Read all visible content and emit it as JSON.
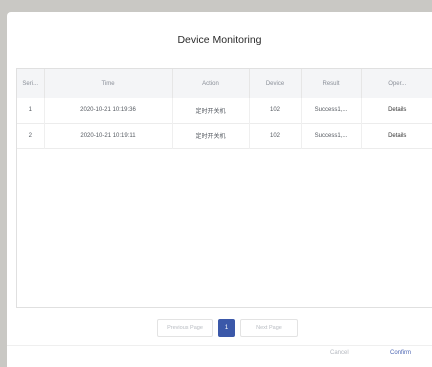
{
  "dialog": {
    "title": "Device Monitoring"
  },
  "table": {
    "headers": [
      "Seri...",
      "Time",
      "Action",
      "Device",
      "Result",
      "Oper..."
    ],
    "rows": [
      {
        "serial": "1",
        "time": "2020-10-21 10:19:36",
        "action": "定时开关机",
        "device": "102",
        "result": "Success1,...",
        "operation": "Details"
      },
      {
        "serial": "2",
        "time": "2020-10-21 10:19:11",
        "action": "定时开关机",
        "device": "102",
        "result": "Success1,...",
        "operation": "Details"
      }
    ]
  },
  "pagination": {
    "previous_label": "Previous Page",
    "current_page": "1",
    "next_label": "Next Page"
  },
  "footer": {
    "cancel_label": "Cancel",
    "confirm_label": "Confirm"
  },
  "colors": {
    "accent": "#3b58a9",
    "confirm_text": "#4d66b4",
    "backdrop": "#c9c8c4"
  }
}
